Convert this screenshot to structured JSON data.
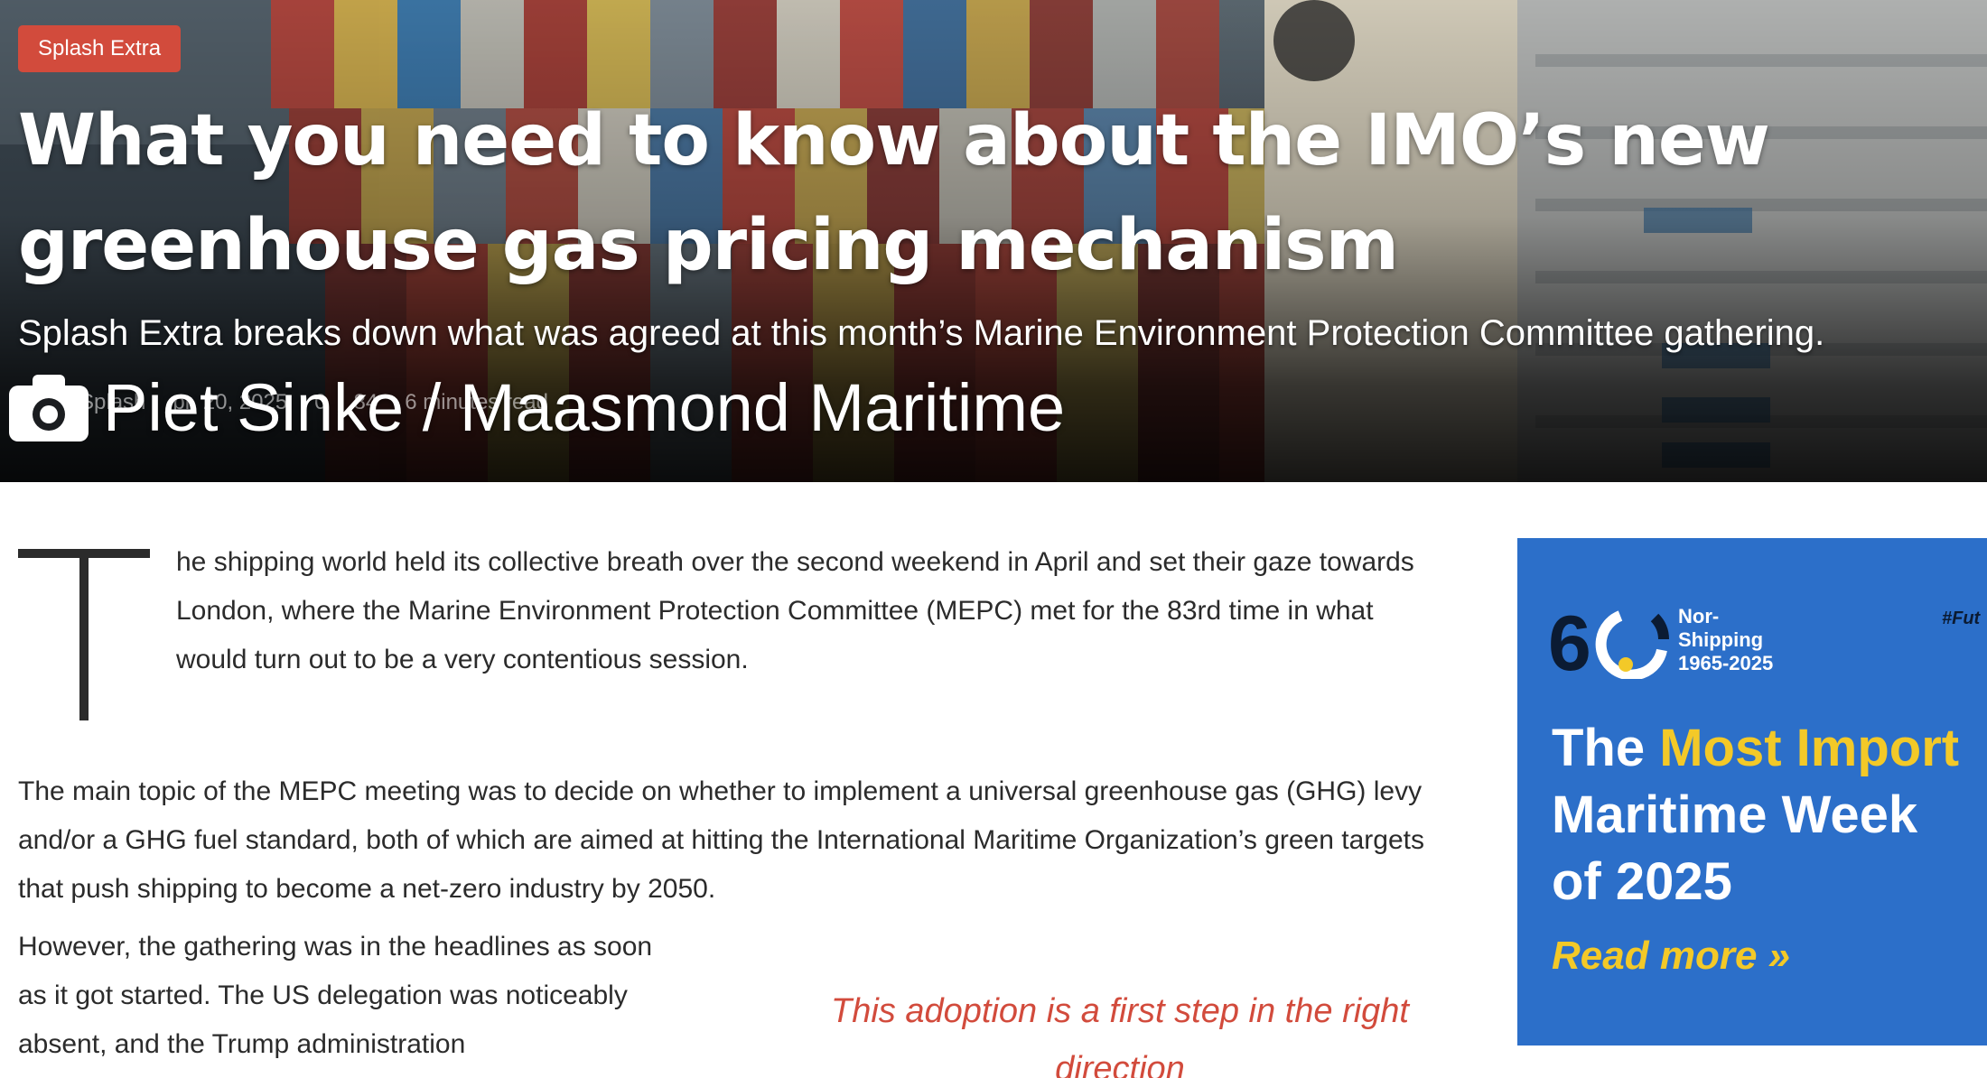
{
  "hero": {
    "category": "Splash Extra",
    "headline": "What you need to know about the IMO’s new greenhouse gas pricing mechanism",
    "subheadline": "Splash Extra breaks down what was agreed at this month’s Marine Environment Protection Committee gathering.",
    "meta": {
      "author": "Splash",
      "date": "pr. 20, 2025",
      "comments": "0",
      "views": "84",
      "read_time": "6 minutes read"
    },
    "photo_credit": "Piet Sinke / Maasmond Maritime"
  },
  "article": {
    "dropcap_letter": "T",
    "p1_rest": "he shipping world held its collective breath over the second weekend in April and set their gaze towards London, where the Marine Environment Protection Committee (MEPC) met for the 83rd time in what would turn out to be a very contentious session.",
    "p2": "The main topic of the MEPC meeting was to decide on whether to implement a universal greenhouse gas (GHG) levy and/or a GHG fuel standard, both of which are aimed at hitting the International Maritime Organization’s green targets that push shipping to become a net-zero industry by 2050.",
    "p3": "However, the gathering was in the headlines as soon as it got started. The US delegation was noticeably absent, and the Trump administration",
    "pull_quote": "This adoption is a first step in the right direction"
  },
  "ad": {
    "brand_line1": "Nor-",
    "brand_line2": "Shipping",
    "brand_line3": "1965-2025",
    "hashtag": "#Fut",
    "title_pre": "The ",
    "title_highlight": "Most Import",
    "title_line2": "Maritime Week",
    "title_line3": "of 2025",
    "cta": "Read more »",
    "colors": {
      "background": "#2c6fc9",
      "highlight": "#f3c928"
    }
  },
  "colors": {
    "accent": "#d24b3c"
  }
}
